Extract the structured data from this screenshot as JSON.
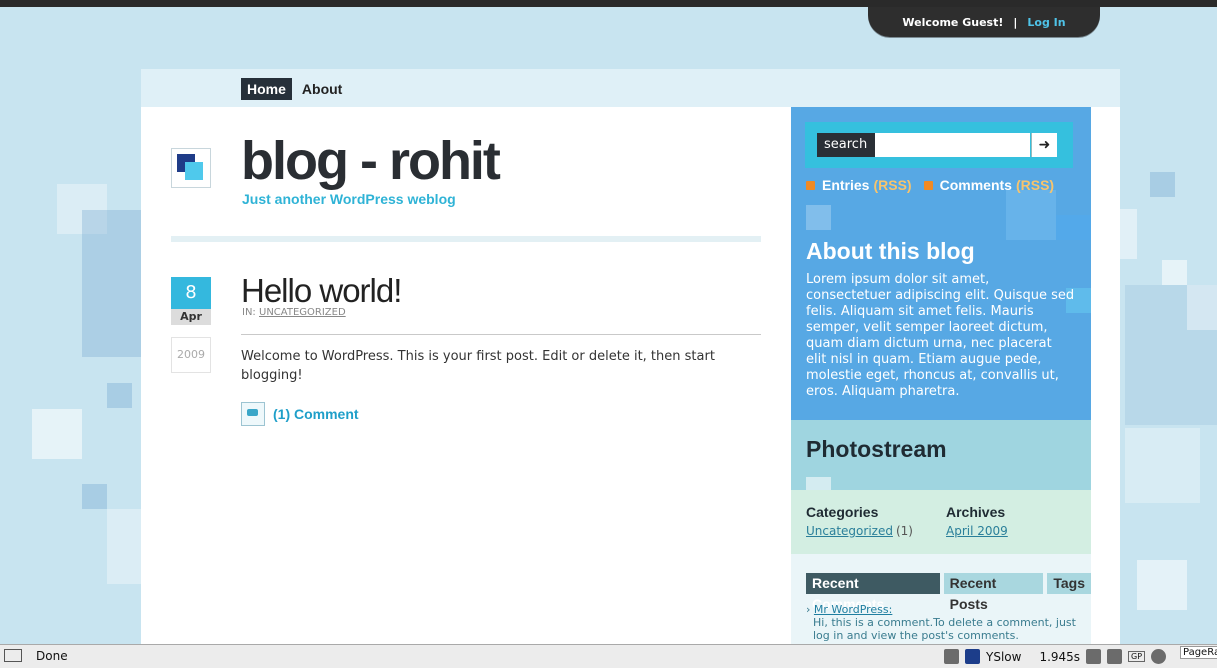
{
  "user_bar": {
    "welcome": "Welcome Guest!",
    "separator": "|",
    "login": "Log In"
  },
  "nav": {
    "items": [
      {
        "label": "Home"
      },
      {
        "label": "About"
      }
    ]
  },
  "site": {
    "title": "blog - rohit",
    "tagline": "Just another WordPress weblog"
  },
  "post": {
    "date": {
      "day": "8",
      "month": "Apr",
      "year": "2009"
    },
    "title": "Hello world!",
    "meta_prefix": "IN:",
    "category": "UNCATEGORIZED",
    "body": "Welcome to WordPress. This is your first post. Edit or delete it, then start blogging!",
    "comments": "(1) Comment"
  },
  "sidebar": {
    "search": {
      "label": "search",
      "placeholder": "",
      "button_icon": "arrow-right-icon",
      "button_glyph": "➜"
    },
    "rss": {
      "entries": "Entries",
      "comments": "Comments",
      "rss": "(RSS)"
    },
    "about": {
      "title": "About this blog",
      "text": "Lorem ipsum dolor sit amet, consectetuer adipiscing elit. Quisque sed felis. Aliquam sit amet felis. Mauris semper, velit semper laoreet dictum, quam diam dictum urna, nec placerat elit nisl in quam. Etiam augue pede, molestie eget, rhoncus at, convallis ut, eros. Aliquam pharetra."
    },
    "photostream": {
      "title": "Photostream"
    },
    "categories": {
      "title": "Categories",
      "item": "Uncategorized",
      "count": "(1)"
    },
    "archives": {
      "title": "Archives",
      "item": "April 2009"
    },
    "tabs": [
      {
        "label": "Recent Comments"
      },
      {
        "label": "Recent Posts"
      },
      {
        "label": "Tags"
      }
    ],
    "recent_comment": {
      "author": "Mr WordPress:",
      "text": "Hi, this is a comment.To delete a comment, just log in and view the post's comments."
    }
  },
  "status_bar": {
    "status": "Done",
    "yslow": "YSlow",
    "load_time": "1.945s",
    "gp": "GP",
    "pagerank": "PageRa"
  },
  "colors": {
    "background": "#c8e4f0",
    "accent": "#34b8de",
    "sidebar_blue": "#57a8e4",
    "photostream": "#9fd5e0",
    "categories_bg": "#d3eee2"
  }
}
